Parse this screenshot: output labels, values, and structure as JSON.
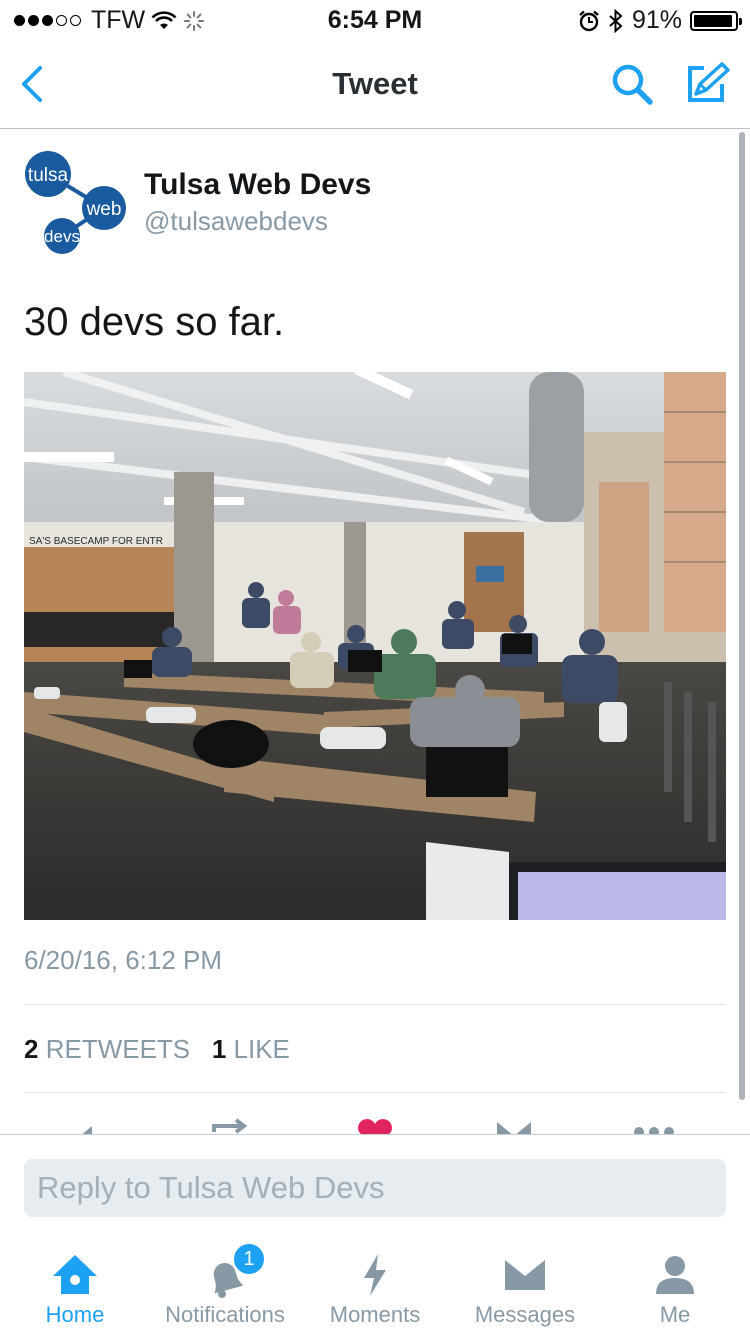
{
  "status_bar": {
    "carrier": "TFW",
    "time": "6:54 PM",
    "battery_percent": "91%",
    "battery_level": 0.91,
    "signal_bars_filled": 3,
    "signal_bars_total": 5
  },
  "nav": {
    "title": "Tweet",
    "back_icon": "chevron-left-icon",
    "search_icon": "search-icon",
    "compose_icon": "compose-icon"
  },
  "tweet": {
    "author_name": "Tulsa Web Devs",
    "author_handle": "@tulsawebdevs",
    "avatar_words": [
      "tulsa",
      "web",
      "devs"
    ],
    "text": "30 devs so far.",
    "timestamp": "6/20/16, 6:12 PM",
    "retweets_count": "2",
    "retweets_label": "RETWEETS",
    "likes_count": "1",
    "likes_label": "LIKE",
    "photo_sign_text": "SA'S BASECAMP FOR ENTR"
  },
  "reply": {
    "placeholder": "Reply to Tulsa Web Devs"
  },
  "tabs": [
    {
      "label": "Home",
      "icon": "home-icon",
      "active": true
    },
    {
      "label": "Notifications",
      "icon": "bell-icon",
      "badge": "1"
    },
    {
      "label": "Moments",
      "icon": "lightning-icon"
    },
    {
      "label": "Messages",
      "icon": "envelope-icon"
    },
    {
      "label": "Me",
      "icon": "person-icon"
    }
  ],
  "colors": {
    "accent": "#1da1f2",
    "like_red": "#e0245e",
    "secondary_text": "#8899a6",
    "avatar_blue": "#1a5a9e"
  }
}
